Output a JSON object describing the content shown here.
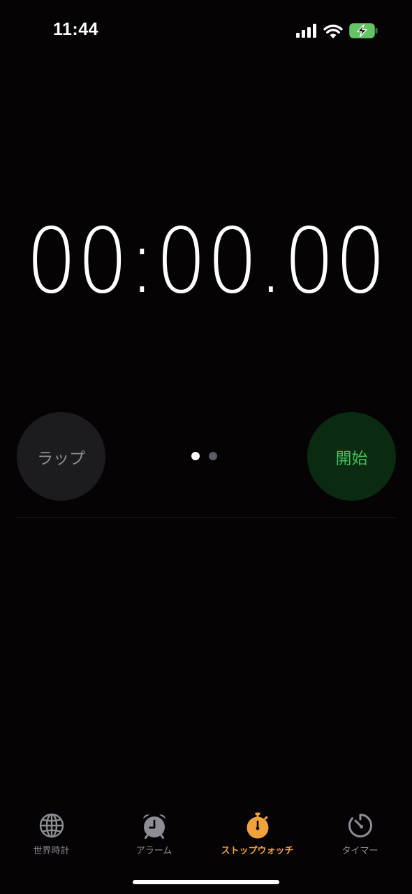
{
  "status_bar": {
    "time": "11:44",
    "icons": [
      "cellular-signal-icon",
      "wifi-icon",
      "battery-charging-icon"
    ],
    "battery_color": "#65c466"
  },
  "stopwatch": {
    "display": "00:00.00",
    "lap_label": "ラップ",
    "start_label": "開始",
    "page_count": 2,
    "active_page": 1
  },
  "tabs": [
    {
      "label": "世界時計",
      "icon": "globe-icon",
      "active": false
    },
    {
      "label": "アラーム",
      "icon": "alarm-clock-icon",
      "active": false
    },
    {
      "label": "ストップウォッチ",
      "icon": "stopwatch-icon",
      "active": true
    },
    {
      "label": "タイマー",
      "icon": "timer-icon",
      "active": false
    }
  ],
  "colors": {
    "background": "#060304",
    "accent": "#f0a23c",
    "start_text": "#3fbf5a",
    "start_bg": "#0b2a12",
    "lap_bg": "#1c1c1e",
    "inactive": "#8d8d93"
  }
}
